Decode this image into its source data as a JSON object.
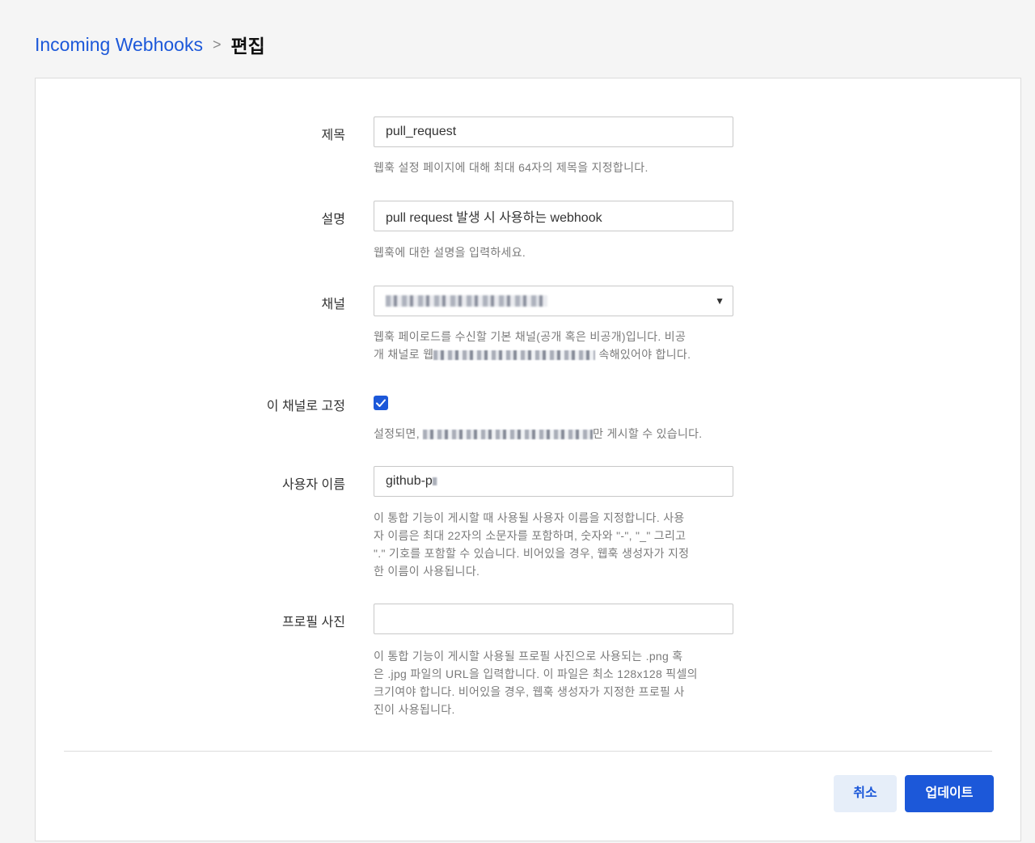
{
  "breadcrumb": {
    "parent": "Incoming Webhooks",
    "separator": ">",
    "current": "편집"
  },
  "form": {
    "title": {
      "label": "제목",
      "value": "pull_request",
      "help": "웹훅 설정 페이지에 대해 최대 64자의 제목을 지정합니다."
    },
    "description": {
      "label": "설명",
      "value": "pull request 발생 시 사용하는 webhook",
      "help": "웹훅에 대한 설명을 입력하세요."
    },
    "channel": {
      "label": "채널",
      "help_line1": "웹훅 페이로드를 수신할 기본 채널(공개 혹은 비공개)입니다. 비공",
      "help_line2_start": "개 채널로 웹",
      "help_line2_end": "속해있어야 합니다."
    },
    "lock_channel": {
      "label": "이 채널로 고정",
      "checked": true,
      "help_start": "설정되면, ",
      "help_end": "만 게시할 수 있습니다."
    },
    "username": {
      "label": "사용자 이름",
      "value": "github-p",
      "help_line1": "이 통합 기능이 게시할 때 사용될 사용자 이름을 지정합니다. 사용",
      "help_line2": "자 이름은 최대 22자의 소문자를 포함하며, 숫자와 \"-\", \"_\" 그리고",
      "help_line3": "\".\" 기호를 포함할 수 있습니다. 비어있을 경우, 웹훅 생성자가 지정",
      "help_line4": "한 이름이 사용됩니다."
    },
    "profile_picture": {
      "label": "프로필 사진",
      "value": "",
      "help_line1": "이 통합 기능이 게시할 사용될 프로필 사진으로 사용되는 .png 혹",
      "help_line2": "은 .jpg 파일의 URL을 입력합니다. 이 파일은 최소 128x128 픽셀의",
      "help_line3": "크기여야 합니다. 비어있을 경우, 웹훅 생성자가 지정한 프로필 사",
      "help_line4": "진이 사용됩니다."
    }
  },
  "actions": {
    "cancel": "취소",
    "update": "업데이트"
  },
  "colors": {
    "accent": "#1c58d9",
    "cancel_bg": "#e6eef9"
  }
}
